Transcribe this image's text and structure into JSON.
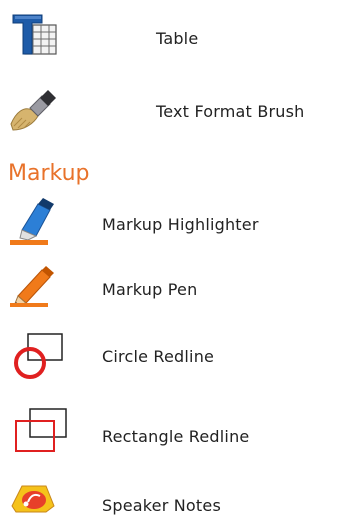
{
  "tools": {
    "table": {
      "label": "Table",
      "icon": "table-icon"
    },
    "brush": {
      "label": "Text Format Brush",
      "icon": "format-brush-icon"
    }
  },
  "markup": {
    "title": "Markup",
    "title_color": "#e8722a",
    "items": [
      {
        "label": "Markup Highlighter",
        "icon": "highlighter-icon"
      },
      {
        "label": "Markup Pen",
        "icon": "pen-icon"
      },
      {
        "label": "Circle Redline",
        "icon": "circle-redline-icon"
      },
      {
        "label": "Rectangle Redline",
        "icon": "rectangle-redline-icon"
      },
      {
        "label": "Speaker Notes",
        "icon": "speaker-notes-icon"
      }
    ]
  }
}
